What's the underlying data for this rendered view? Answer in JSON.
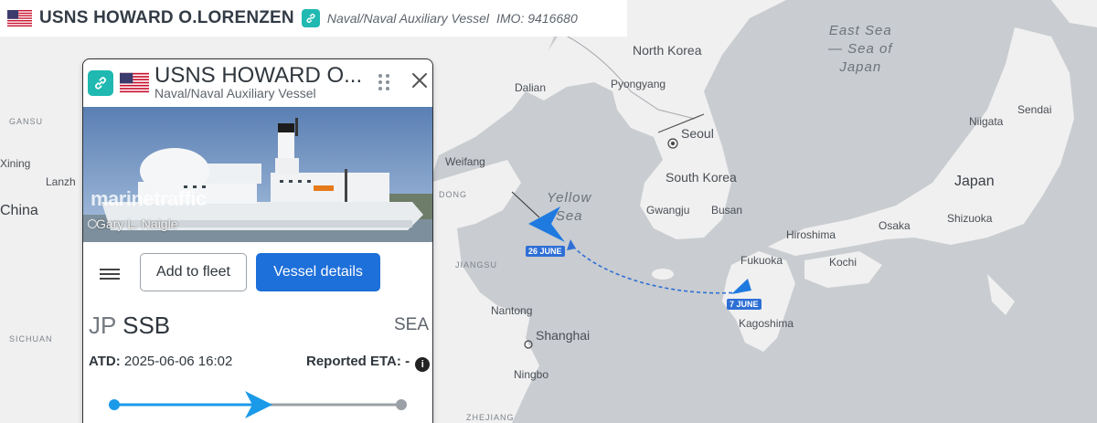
{
  "vessel": {
    "name": "USNS HOWARD O.LORENZEN",
    "name_truncated": "USNS HOWARD O...",
    "type": "Naval/Naval Auxiliary Vessel",
    "type_top": "Naval/Naval Auxiliary Vessel",
    "imo": "IMO: 9416680",
    "flag": "us-flag-icon"
  },
  "card": {
    "watermark": "marinetraffic",
    "photo_credit": "Gary L. Naigle",
    "add_to_fleet": "Add to fleet",
    "vessel_details": "Vessel details",
    "departure_country": "JP",
    "departure_port": "SSB",
    "arrival": "SEA",
    "atd_label": "ATD:",
    "atd_value": "2025-06-06 16:02",
    "eta_label": "Reported ETA:",
    "eta_value": "-",
    "voyage_progress": 0.5
  },
  "map": {
    "places": {
      "north_korea": "North Korea",
      "pyongyang": "Pyongyang",
      "dalian": "Dalian",
      "seoul": "Seoul",
      "south_korea": "South Korea",
      "gwangju": "Gwangju",
      "busan": "Busan",
      "weifang": "Weifang",
      "dong": "DONG",
      "jiangsu": "JIANGSU",
      "nantong": "Nantong",
      "shanghai": "Shanghai",
      "ningbo": "Ningbo",
      "zhejiang": "ZHEJIANG",
      "sichuan": "SICHUAN",
      "gansu": "GANSU",
      "xining": "Xining",
      "lanzhou": "Lanzh",
      "china": "China",
      "fukuoka": "Fukuoka",
      "hiroshima": "Hiroshima",
      "kochi": "Kochi",
      "kagoshima": "Kagoshima",
      "osaka": "Osaka",
      "shizuoka": "Shizuoka",
      "japan": "Japan",
      "niigata": "Niigata",
      "sendai": "Sendai"
    },
    "seas": {
      "yellow_sea_line1": "Yellow",
      "yellow_sea_line2": "Sea",
      "east_sea_line1": "East Sea",
      "east_sea_line2": "— Sea of",
      "east_sea_line3": "Japan"
    },
    "track_labels": {
      "start": "7 JUNE",
      "end": "26 JUNE"
    },
    "colors": {
      "land": "#f2f2f2",
      "sea": "#c9ccd0",
      "route": "#2e6fd6",
      "vessel": "#1f7ae0"
    }
  }
}
